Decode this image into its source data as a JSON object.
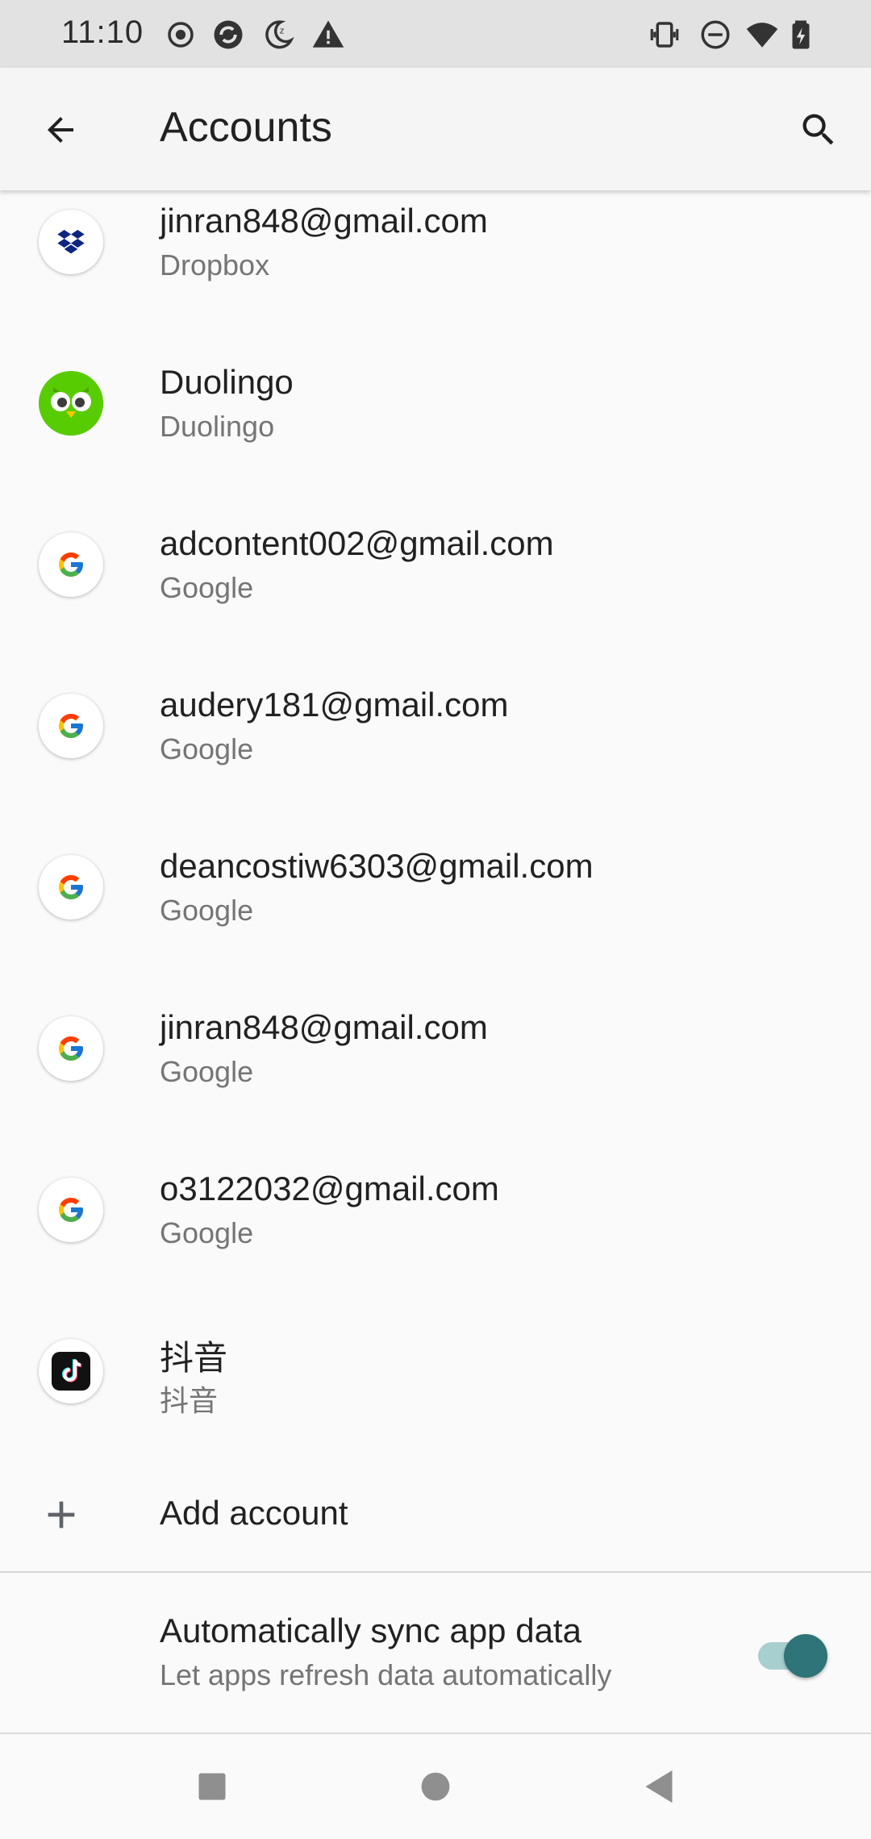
{
  "status_bar": {
    "time": "11:10",
    "left_icons": [
      "record-icon",
      "sync-app-icon",
      "night-mode-icon",
      "warning-icon"
    ],
    "right_icons": [
      "vibrate-icon",
      "do-not-disturb-icon",
      "wifi-icon",
      "battery-icon"
    ]
  },
  "app_bar": {
    "title": "Accounts",
    "back_icon": "arrow-back-icon",
    "search_icon": "search-icon"
  },
  "accounts": [
    {
      "name": "jinran848@gmail.com",
      "type": "Dropbox",
      "icon": "dropbox-icon"
    },
    {
      "name": "Duolingo",
      "type": "Duolingo",
      "icon": "duolingo-icon"
    },
    {
      "name": "adcontent002@gmail.com",
      "type": "Google",
      "icon": "google-icon"
    },
    {
      "name": "audery181@gmail.com",
      "type": "Google",
      "icon": "google-icon"
    },
    {
      "name": "deancostiw6303@gmail.com",
      "type": "Google",
      "icon": "google-icon"
    },
    {
      "name": "jinran848@gmail.com",
      "type": "Google",
      "icon": "google-icon"
    },
    {
      "name": "o3122032@gmail.com",
      "type": "Google",
      "icon": "google-icon"
    },
    {
      "name": "抖音",
      "type": "抖音",
      "icon": "douyin-icon"
    }
  ],
  "add_account": {
    "label": "Add account",
    "icon": "plus-icon"
  },
  "sync": {
    "title": "Automatically sync app data",
    "subtitle": "Let apps refresh data automatically",
    "enabled": true
  },
  "nav_bar": {
    "icons": [
      "recents-icon",
      "home-icon",
      "back-icon"
    ]
  },
  "colors": {
    "accent": "#2e7478",
    "toggle_track": "#a8cfcf",
    "status_bar_bg": "#e2e2e2",
    "dropbox_blue": "#0d2481",
    "duolingo_green": "#58cc02"
  }
}
